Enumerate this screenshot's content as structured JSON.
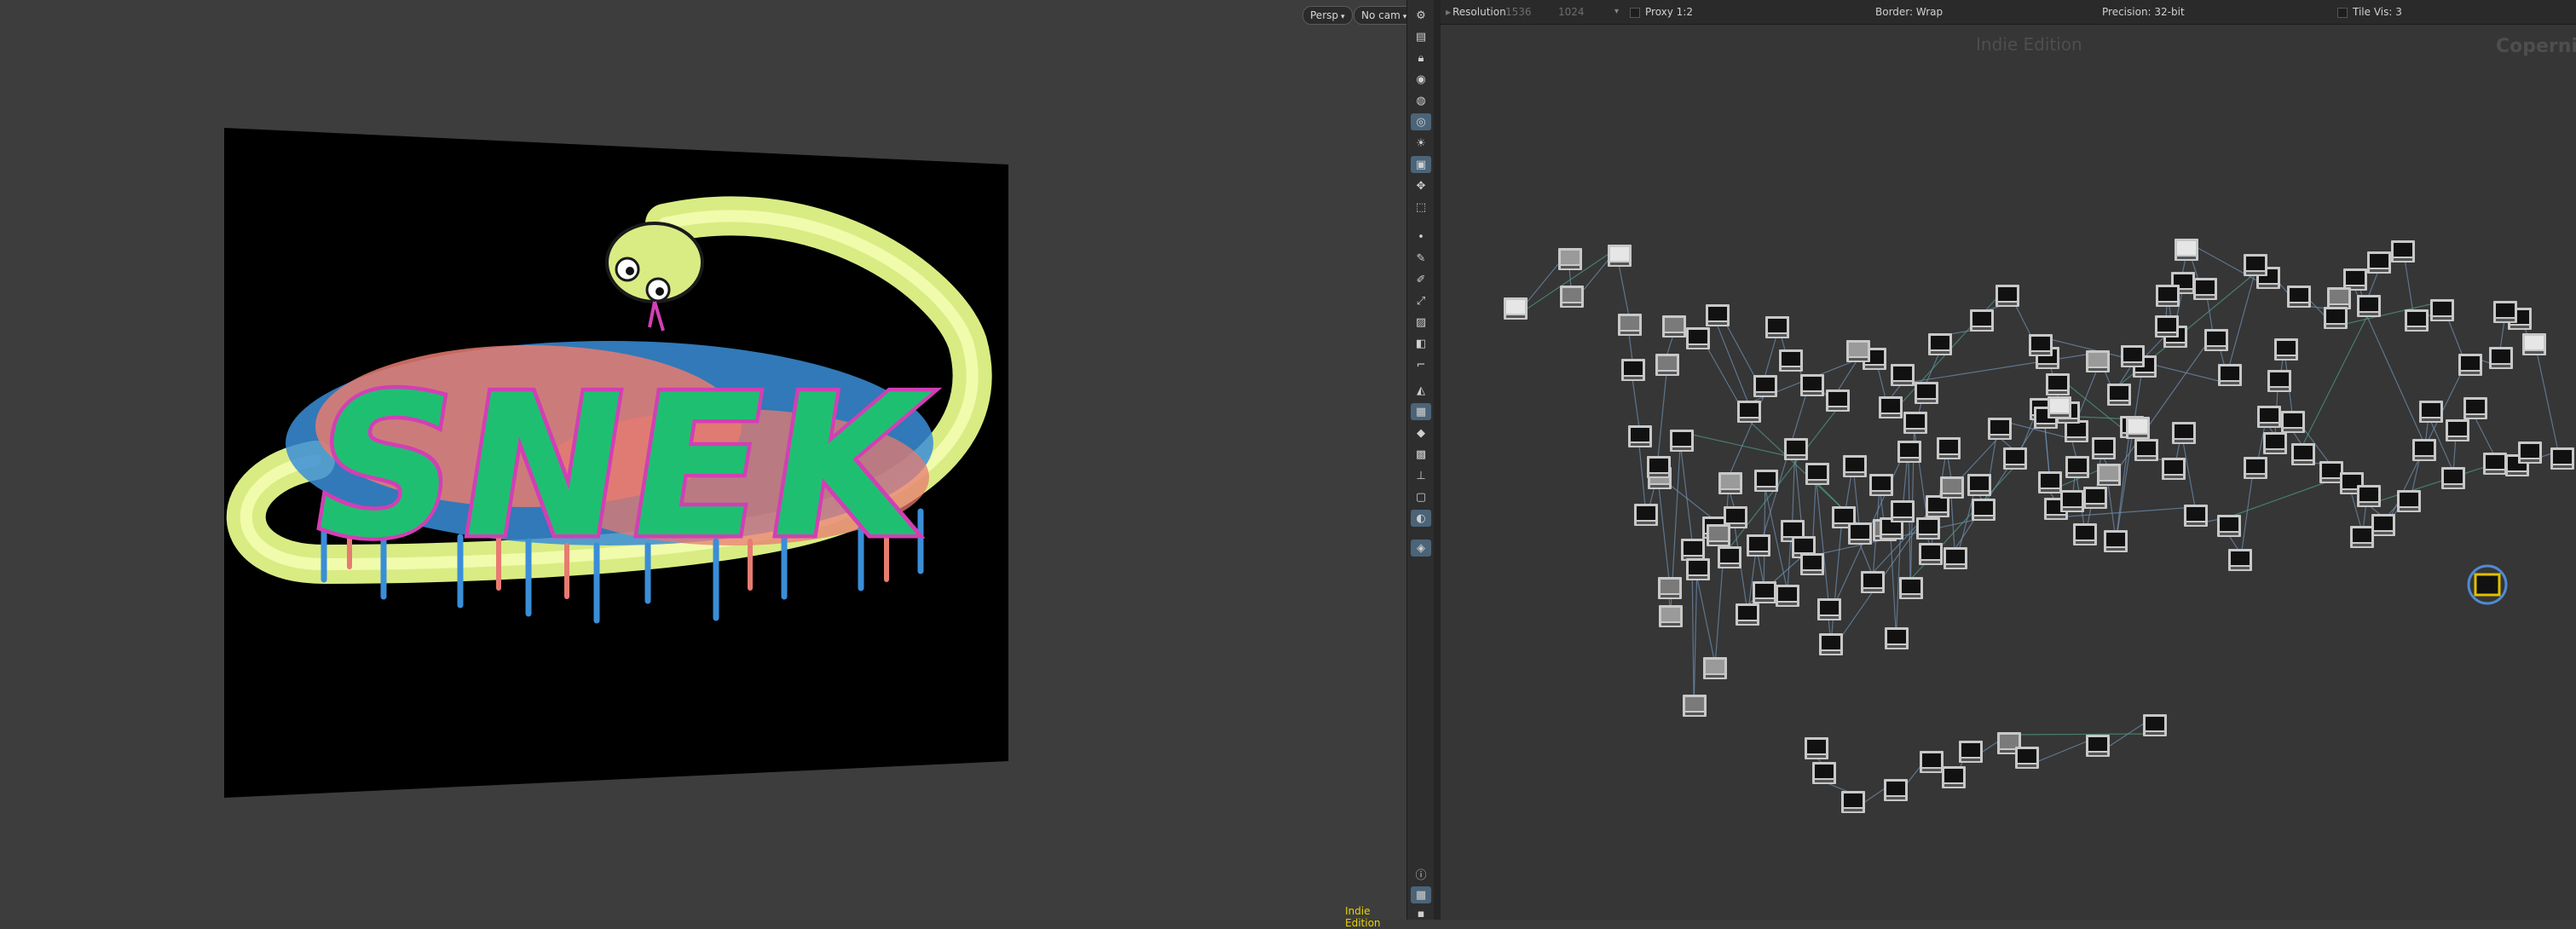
{
  "viewport": {
    "camera_view_label": "Persp",
    "camera_label": "No cam",
    "indie_label": "Indie Edition",
    "artwork_text": "SNEK"
  },
  "toolbar": {
    "icons": [
      "display-options-icon",
      "layers-icon",
      "lock-icon",
      "visibility-icon",
      "snapshot-icon",
      "camera-icon",
      "light-icon",
      "render-icon",
      "handle-icon",
      "select-icon",
      "point-icon",
      "brush-icon",
      "pin-icon",
      "transform-icon",
      "paint-icon",
      "sculpt-icon",
      "edge-icon",
      "paint-bucket-icon",
      "grid-icon",
      "primitive-icon",
      "uv-icon",
      "joint-icon",
      "bounding-box-icon",
      "shading-icon",
      "geo-icon",
      "info-icon",
      "layout-icon",
      "settings-icon"
    ]
  },
  "network": {
    "resolution_label": "Resolution",
    "resolution_x": "1536",
    "resolution_y": "1024",
    "proxy_label": "Proxy 1:2",
    "border_label": "Border: Wrap",
    "precision_label": "Precision: 32-bit",
    "tile_vis_label": "Tile Vis: 3",
    "indie_label": "Indie Edition",
    "context_label": "Copernicus",
    "accent_color": "#e0c000",
    "wire_color": "#6f90b3",
    "wire_color_green": "#4f9c84"
  }
}
